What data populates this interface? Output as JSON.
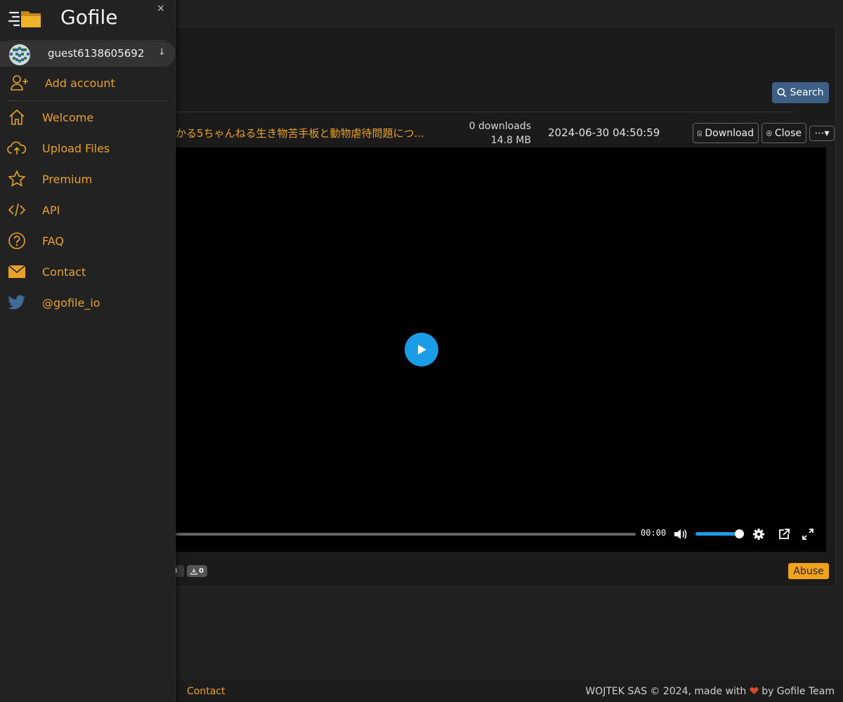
{
  "sidebar": {
    "brand": "Gofile",
    "close_label": "×",
    "account": {
      "name": "guest6138605692",
      "arrow": "↓"
    },
    "add_account": "Add account",
    "items": [
      {
        "label": "Welcome",
        "icon": "home-icon"
      },
      {
        "label": "Upload Files",
        "icon": "cloud-upload-icon"
      },
      {
        "label": "Premium",
        "icon": "star-icon"
      },
      {
        "label": "API",
        "icon": "code-icon"
      },
      {
        "label": "FAQ",
        "icon": "question-circle-icon"
      },
      {
        "label": "Contact",
        "icon": "envelope-icon"
      },
      {
        "label": "@gofile_io",
        "icon": "twitter-icon"
      }
    ]
  },
  "toolbar": {
    "search_label": "Search"
  },
  "file": {
    "name": "かる5ちゃんねる生き物苦手板と動物虐待問題につ...",
    "downloads": "0 downloads",
    "size": "14.8 MB",
    "date": "2024-06-30 04:50:59",
    "download_label": "Download",
    "close_label": "Close",
    "more_label": "⋯▾"
  },
  "player": {
    "time": "00:00",
    "progress": 0,
    "volume": 1.0
  },
  "badges": {
    "left_partial": "B",
    "downloads_count": "0"
  },
  "abuse_label": "Abuse",
  "footer": {
    "contact": "Contact",
    "copyright_prefix": "WOJTEK SAS © 2024, made with",
    "copyright_suffix": "by Gofile Team"
  },
  "colors": {
    "accent": "#e8a22a",
    "player_blue": "#1a9ce6",
    "search_blue": "#3d5f86",
    "abuse_orange": "#f0a21d",
    "heart_red": "#e0452c"
  }
}
